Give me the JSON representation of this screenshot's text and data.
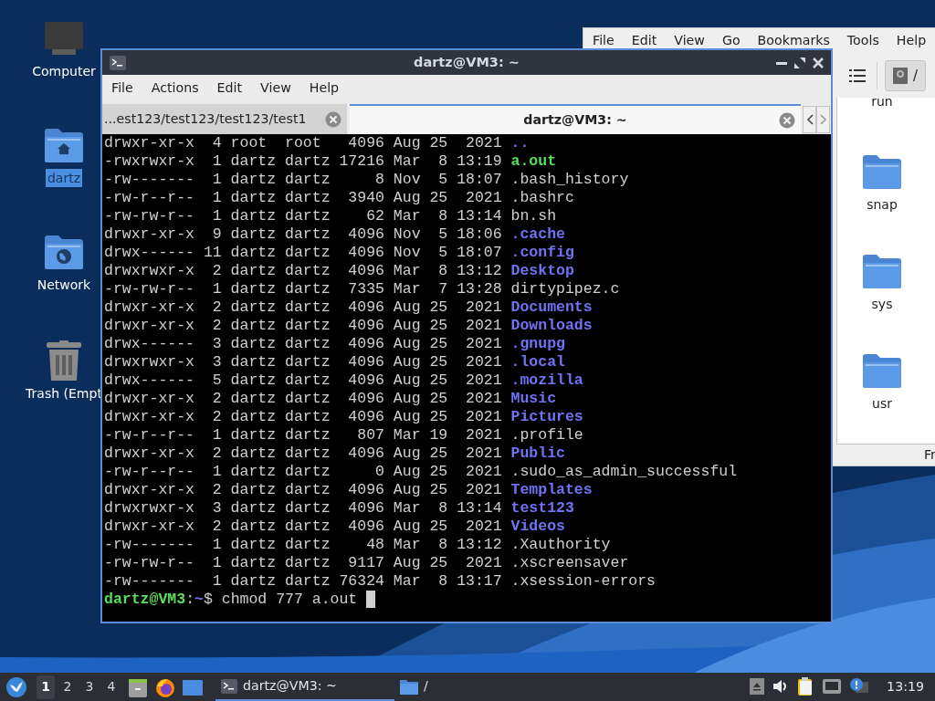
{
  "desktop_icons": [
    {
      "label": "Computer",
      "kind": "computer",
      "selected": false
    },
    {
      "label": "dartz",
      "kind": "home",
      "selected": true
    },
    {
      "label": "Network",
      "kind": "network",
      "selected": false
    },
    {
      "label": "Trash (Empt",
      "kind": "trash",
      "selected": false
    }
  ],
  "file_manager": {
    "menu": [
      "File",
      "Edit",
      "View",
      "Go",
      "Bookmarks",
      "Tools",
      "Help"
    ],
    "location": "/",
    "items": [
      {
        "label": "run",
        "kind": "partial"
      },
      {
        "label": "snap",
        "kind": "folder"
      },
      {
        "label": "sys",
        "kind": "folder"
      },
      {
        "label": "usr",
        "kind": "folder"
      }
    ],
    "status": "Fr"
  },
  "terminal": {
    "title": "dartz@VM3: ~",
    "menu": [
      "File",
      "Actions",
      "Edit",
      "View",
      "Help"
    ],
    "tabs": [
      {
        "label": "...est123/test123/test123/test1",
        "selected": false
      },
      {
        "label": "dartz@VM3: ~",
        "selected": true
      }
    ],
    "lines": [
      {
        "text": "drwxr-xr-x  4 root  root   4096 Aug 25  2021",
        "name": "..",
        "kind": "dir"
      },
      {
        "text": "-rwxrwxr-x  1 dartz dartz 17216 Mar  8 13:19",
        "name": "a.out",
        "kind": "exec"
      },
      {
        "text": "-rw-------  1 dartz dartz     8 Nov  5 18:07",
        "name": ".bash_history",
        "kind": "file"
      },
      {
        "text": "-rw-r--r--  1 dartz dartz  3940 Aug 25  2021",
        "name": ".bashrc",
        "kind": "file"
      },
      {
        "text": "-rw-rw-r--  1 dartz dartz    62 Mar  8 13:14",
        "name": "bn.sh",
        "kind": "file"
      },
      {
        "text": "drwxr-xr-x  9 dartz dartz  4096 Nov  5 18:06",
        "name": ".cache",
        "kind": "dir"
      },
      {
        "text": "drwx------ 11 dartz dartz  4096 Nov  5 18:07",
        "name": ".config",
        "kind": "dir"
      },
      {
        "text": "drwxrwxr-x  2 dartz dartz  4096 Mar  8 13:12",
        "name": "Desktop",
        "kind": "dir"
      },
      {
        "text": "-rw-rw-r--  1 dartz dartz  7335 Mar  7 13:28",
        "name": "dirtypipez.c",
        "kind": "file"
      },
      {
        "text": "drwxr-xr-x  2 dartz dartz  4096 Aug 25  2021",
        "name": "Documents",
        "kind": "dir"
      },
      {
        "text": "drwxr-xr-x  2 dartz dartz  4096 Aug 25  2021",
        "name": "Downloads",
        "kind": "dir"
      },
      {
        "text": "drwx------  3 dartz dartz  4096 Aug 25  2021",
        "name": ".gnupg",
        "kind": "dir"
      },
      {
        "text": "drwxrwxr-x  3 dartz dartz  4096 Aug 25  2021",
        "name": ".local",
        "kind": "dir"
      },
      {
        "text": "drwx------  5 dartz dartz  4096 Aug 25  2021",
        "name": ".mozilla",
        "kind": "dir"
      },
      {
        "text": "drwxr-xr-x  2 dartz dartz  4096 Aug 25  2021",
        "name": "Music",
        "kind": "dir"
      },
      {
        "text": "drwxr-xr-x  2 dartz dartz  4096 Aug 25  2021",
        "name": "Pictures",
        "kind": "dir"
      },
      {
        "text": "-rw-r--r--  1 dartz dartz   807 Mar 19  2021",
        "name": ".profile",
        "kind": "file"
      },
      {
        "text": "drwxr-xr-x  2 dartz dartz  4096 Aug 25  2021",
        "name": "Public",
        "kind": "dir"
      },
      {
        "text": "-rw-r--r--  1 dartz dartz     0 Aug 25  2021",
        "name": ".sudo_as_admin_successful",
        "kind": "file"
      },
      {
        "text": "drwxr-xr-x  2 dartz dartz  4096 Aug 25  2021",
        "name": "Templates",
        "kind": "dir"
      },
      {
        "text": "drwxrwxr-x  3 dartz dartz  4096 Mar  8 13:14",
        "name": "test123",
        "kind": "dir"
      },
      {
        "text": "drwxr-xr-x  2 dartz dartz  4096 Aug 25  2021",
        "name": "Videos",
        "kind": "dir"
      },
      {
        "text": "-rw-------  1 dartz dartz    48 Mar  8 13:12",
        "name": ".Xauthority",
        "kind": "file"
      },
      {
        "text": "-rw-rw-r--  1 dartz dartz  9117 Aug 25  2021",
        "name": ".xscreensaver",
        "kind": "file"
      },
      {
        "text": "-rw-------  1 dartz dartz 76324 Mar  8 13:17",
        "name": ".xsession-errors",
        "kind": "file"
      }
    ],
    "prompt": {
      "user_host": "dartz@VM3",
      "separator": ":",
      "path": "~",
      "symbol": "$",
      "command": "chmod 777 a.out"
    }
  },
  "taskbar": {
    "workspaces": [
      {
        "label": "1",
        "selected": true
      },
      {
        "label": "2",
        "selected": false
      },
      {
        "label": "3",
        "selected": false
      },
      {
        "label": "4",
        "selected": false
      }
    ],
    "tasks": [
      {
        "label": "dartz@VM3: ~",
        "kind": "terminal",
        "selected": true
      },
      {
        "label": "/",
        "kind": "folder",
        "selected": false
      }
    ],
    "clock": "13:19"
  }
}
